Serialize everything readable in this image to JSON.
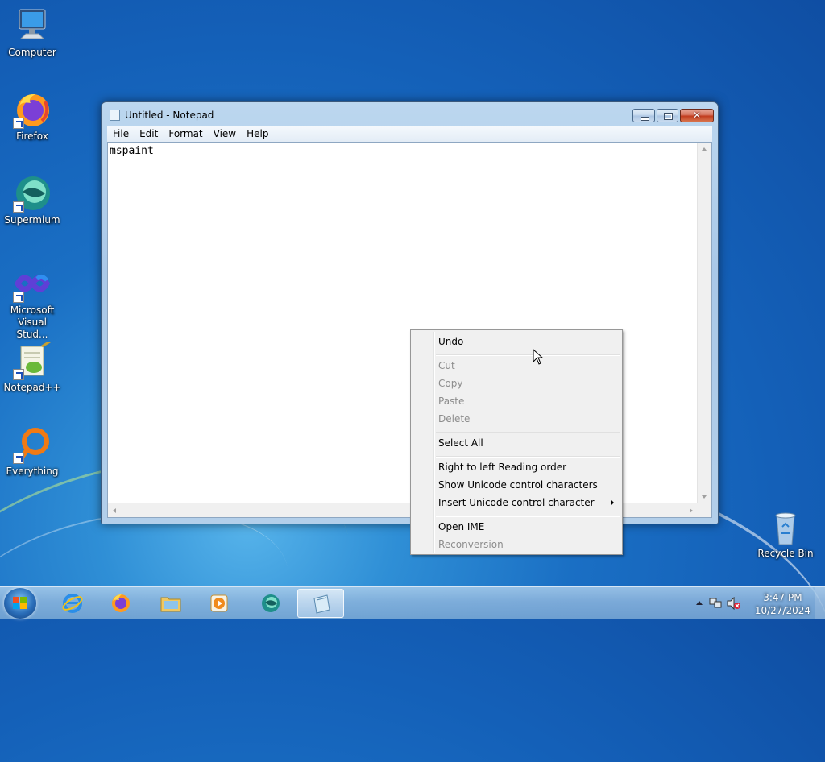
{
  "desktop": {
    "icons": [
      {
        "label": "Computer"
      },
      {
        "label": "Firefox"
      },
      {
        "label": "Supermium"
      },
      {
        "label": "Microsoft Visual Stud..."
      },
      {
        "label": "Notepad++"
      },
      {
        "label": "Everything"
      },
      {
        "label": "Recycle Bin"
      }
    ]
  },
  "window": {
    "title": "Untitled - Notepad",
    "menu": [
      "File",
      "Edit",
      "Format",
      "View",
      "Help"
    ],
    "content": "mspaint"
  },
  "context_menu": {
    "items": [
      {
        "label": "Undo",
        "enabled": true
      },
      {
        "label": "Cut",
        "enabled": false
      },
      {
        "label": "Copy",
        "enabled": false
      },
      {
        "label": "Paste",
        "enabled": false
      },
      {
        "label": "Delete",
        "enabled": false
      },
      {
        "label": "Select All",
        "enabled": true
      },
      {
        "label": "Right to left Reading order",
        "enabled": true
      },
      {
        "label": "Show Unicode control characters",
        "enabled": true
      },
      {
        "label": "Insert Unicode control character",
        "enabled": true,
        "submenu": true
      },
      {
        "label": "Open IME",
        "enabled": true
      },
      {
        "label": "Reconversion",
        "enabled": false
      }
    ]
  },
  "taskbar": {
    "apps": [
      "Internet Explorer",
      "Firefox",
      "Windows Explorer",
      "Windows Media Player",
      "Supermium",
      "Notepad"
    ],
    "clock": {
      "time": "3:47 PM",
      "date": "10/27/2024"
    }
  },
  "colors": {
    "title_bar": "#b3cfea",
    "close_button": "#c0391c",
    "menu_bg": "#f0f0f0",
    "disabled_text": "#8d8d8d"
  }
}
